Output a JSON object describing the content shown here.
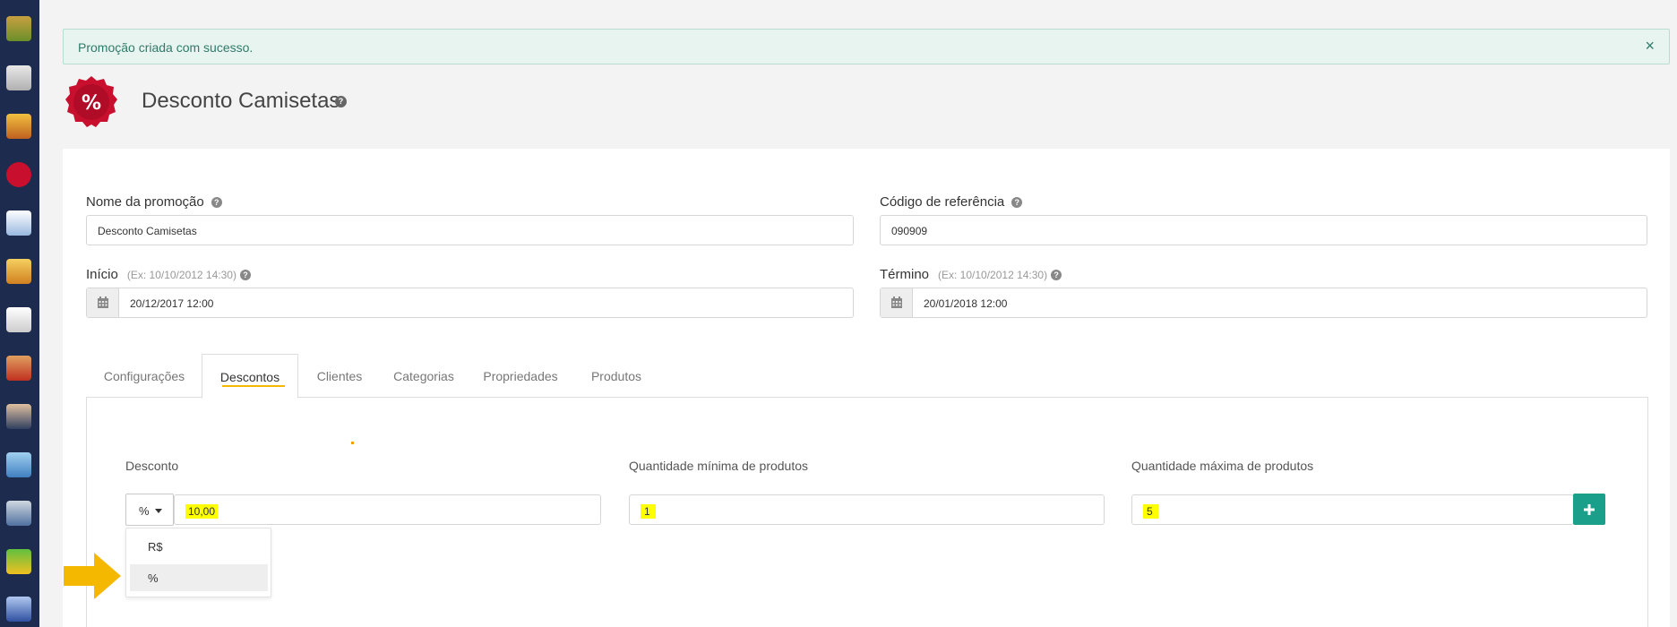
{
  "dock": {
    "icons": [
      "app-icon-1",
      "app-icon-2",
      "app-icon-3",
      "promo-icon",
      "app-icon-5",
      "truck-icon",
      "note-icon",
      "people-icon",
      "user-icon",
      "image-icon",
      "database-icon",
      "chart-icon",
      "app-icon-13"
    ]
  },
  "alert": {
    "message": "Promoção criada com sucesso.",
    "close": "×"
  },
  "header": {
    "badge_symbol": "%",
    "title": "Desconto Camisetas",
    "help": "?"
  },
  "form": {
    "name_label": "Nome da promoção",
    "name_value": "Desconto Camisetas",
    "code_label": "Código de referência",
    "code_value": "090909",
    "start_label": "Início",
    "start_hint": "(Ex: 10/10/2012 14:30)",
    "start_value": "20/12/2017 12:00",
    "end_label": "Término",
    "end_hint": "(Ex: 10/10/2012 14:30)",
    "end_value": "20/01/2018 12:00",
    "help": "?"
  },
  "tabs": [
    {
      "label": "Configurações"
    },
    {
      "label": "Descontos"
    },
    {
      "label": "Clientes"
    },
    {
      "label": "Categorias"
    },
    {
      "label": "Propriedades"
    },
    {
      "label": "Produtos"
    }
  ],
  "active_tab": "Descontos",
  "discount": {
    "discount_label": "Desconto",
    "type_selected": "%",
    "value": "10,00",
    "min_label": "Quantidade mínima de produtos",
    "min_value": "1",
    "max_label": "Quantidade máxima de produtos",
    "max_value": "5",
    "options": [
      "R$",
      "%"
    ]
  },
  "colors": {
    "accent": "#1aa08a",
    "tab_underline": "#f5b800",
    "highlight": "#ffff00",
    "badge": "#c8102e",
    "arrow": "#f5b800"
  }
}
